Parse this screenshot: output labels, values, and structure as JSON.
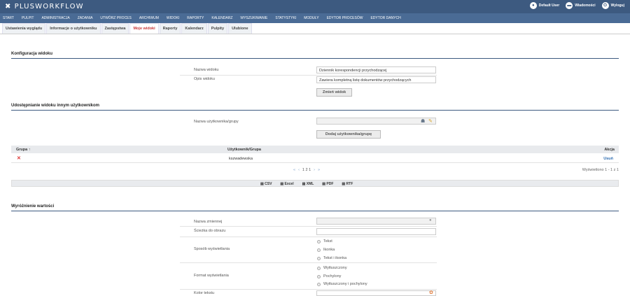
{
  "brand": {
    "mark": "✖",
    "name": "PLUSWORKFLOW"
  },
  "top_right": [
    {
      "icon": "user-icon",
      "label": "Default User"
    },
    {
      "icon": "message-icon",
      "label": "Wiadomości"
    },
    {
      "icon": "power-icon",
      "label": "Wyloguj"
    }
  ],
  "menu": [
    "START",
    "PULPIT",
    "ADMINISTRACJA",
    "ZADANIA",
    "UTWÓRZ PROCES",
    "ARCHIWUM",
    "WIDOKI",
    "RAPORTY",
    "KALENDARZ",
    "WYSZUKIWANIE",
    "STATYSTYKI",
    "MODUŁY",
    "EDYTOR PROCESÓW",
    "EDYTOR DANYCH"
  ],
  "tabs": [
    "Ustawienia wyglądu",
    "Informacje o użytkowniku",
    "Zastępstwa",
    "Moje widoki",
    "Raporty",
    "Kalendarz",
    "Pulpity",
    "Ulubione"
  ],
  "active_tab": "Moje widoki",
  "config": {
    "title": "Konfiguracja widoku",
    "name_label": "Nazwa widoku",
    "name_value": "Dziennik korespondencji przychodzącej",
    "desc_label": "Opis widoku",
    "desc_value": "Zawiera kompletną listę dokumentów przychodzących",
    "button": "Zmień widok"
  },
  "share": {
    "title": "Udostępnianie widoku innym użytkownikom",
    "user_label": "Nazwa użytkownika/grupy",
    "user_value": "",
    "button": "Dodaj użytkownika/grupę"
  },
  "table": {
    "headers": {
      "group": "Grupa ↑",
      "user": "Użytkownik/Grupa",
      "action": "Akcja"
    },
    "rows": [
      {
        "delete": "✕",
        "user": "kszwadewska",
        "action": "Usuń"
      }
    ],
    "pagination": {
      "first": "«",
      "prev": "‹",
      "pages": "1 2 1",
      "next": "›",
      "last": "»"
    },
    "summary": "Wyświetlono 1 - 1 z 1"
  },
  "export": [
    "CSV",
    "Excel",
    "XML",
    "PDF",
    "RTF"
  ],
  "highlight": {
    "title": "Wyróżnienie wartości",
    "var_label": "Nazwa zmiennej",
    "img_label": "Ścieżka do obrazu",
    "display_label": "Sposób wyświetlania",
    "display_options": [
      "Tekst",
      "Ikonka",
      "Tekst i ikonka"
    ],
    "format_label": "Format wyświetlania",
    "format_options": [
      "Wytłuszczony",
      "Pochylony",
      "Wytłuszczony i pochylony"
    ],
    "color_label": "Kolor tekstu"
  }
}
